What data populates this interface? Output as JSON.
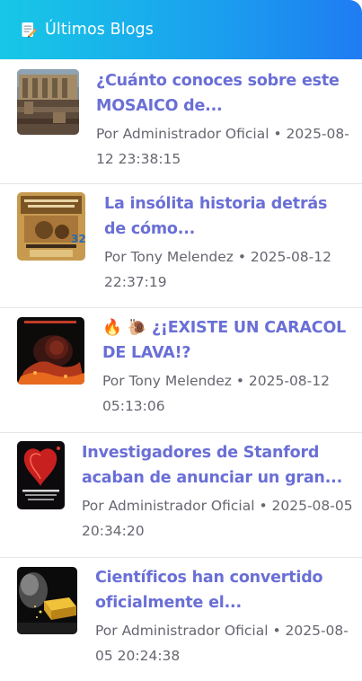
{
  "header": {
    "icon": "memo-pencil-icon",
    "title": "Últimos Blogs",
    "gradient": [
      "#17c8e6",
      "#1f7cf2"
    ]
  },
  "posts": [
    {
      "title": "¿Cuánto conoces sobre este MOSAICO de...",
      "meta": "Por Administrador Oficial • 2025-08-12 23:38:15",
      "thumb": "ruins-mosaic-photo"
    },
    {
      "title": "La insólita historia detrás de cómo...",
      "meta": "Por Tony Melendez • 2025-08-12 22:37:19",
      "thumb": "vintage-poster-photo"
    },
    {
      "title": "🔥 🐌 ¿¡EXISTE UN CARACOL DE LAVA!?",
      "meta": "Por Tony Melendez • 2025-08-12 05:13:06",
      "thumb": "lava-snail-photo"
    },
    {
      "title": "Investigadores de Stanford acaban de anunciar un gran...",
      "meta": "Por Administrador Oficial • 2025-08-05 20:34:20",
      "thumb": "heart-organ-photo"
    },
    {
      "title": "Científicos han convertido oficialmente el...",
      "meta": "Por Administrador Oficial • 2025-08-05 20:24:38",
      "thumb": "gold-bar-photo"
    }
  ],
  "colors": {
    "title": "#6a6fd6",
    "meta": "#666670",
    "divider": "#e6e6e6"
  }
}
